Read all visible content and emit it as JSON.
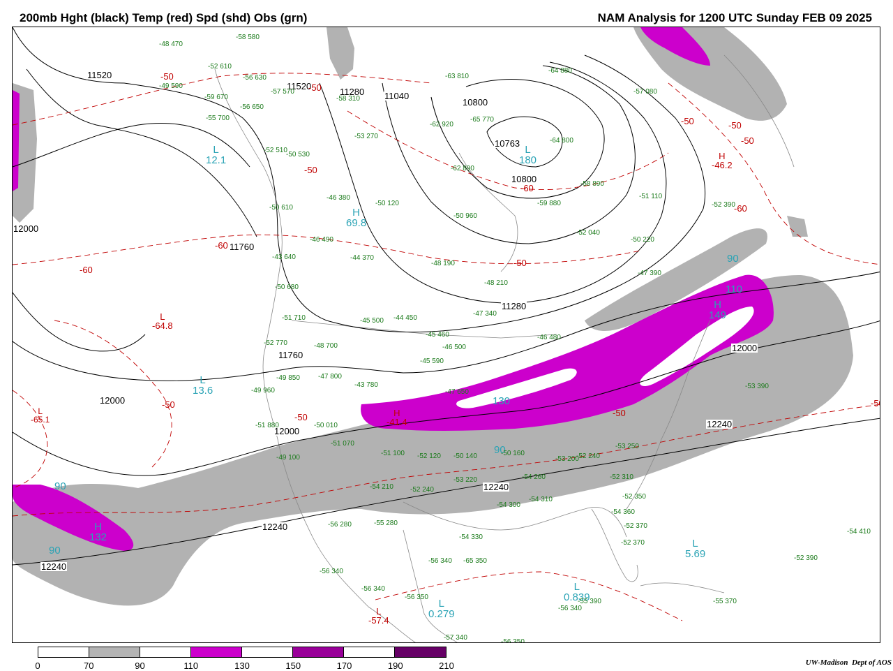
{
  "header": {
    "left": "200mb Hght (black) Temp (red) Spd (shd) Obs (grn)",
    "right": "NAM Analysis for 1200 UTC Sunday  FEB 09 2025"
  },
  "height_labels": [
    "11520",
    "11520",
    "11280",
    "11040",
    "10800",
    "10763",
    "10800",
    "12000",
    "11760",
    "11280",
    "11760",
    "12000",
    "12000",
    "12000",
    "12240",
    "12240",
    "12240",
    "12240",
    "12000"
  ],
  "temp_labels": [
    "-50",
    "-50",
    "-50",
    "-50",
    "-60",
    "-50",
    "-60",
    "-50",
    "-60",
    "-50",
    "-60",
    "-50",
    "-50",
    "-50",
    "-50",
    "-50",
    "-60"
  ],
  "speed_labels": [
    "90",
    "90",
    "90",
    "90",
    "130",
    "110"
  ],
  "centers": [
    {
      "letter": "L",
      "value": "12.1",
      "kind": "spd"
    },
    {
      "letter": "H",
      "value": "69.8",
      "kind": "spd"
    },
    {
      "letter": "L",
      "value": "180",
      "kind": "spd"
    },
    {
      "letter": "L",
      "value": "-64.8",
      "kind": "tmp"
    },
    {
      "letter": "H",
      "value": "-46.2",
      "kind": "tmp"
    },
    {
      "letter": "L",
      "value": "13.6",
      "kind": "spd"
    },
    {
      "letter": "L",
      "value": "-65.1",
      "kind": "tmp"
    },
    {
      "letter": "H",
      "value": "-41.4",
      "kind": "tmp"
    },
    {
      "letter": "H",
      "value": "149",
      "kind": "spd"
    },
    {
      "letter": "H",
      "value": "132",
      "kind": "spd"
    },
    {
      "letter": "L",
      "value": "5.69",
      "kind": "spd"
    },
    {
      "letter": "L",
      "value": "0.279",
      "kind": "spd"
    },
    {
      "letter": "L",
      "value": "0.839",
      "kind": "spd"
    },
    {
      "letter": "L",
      "value": "-57.4",
      "kind": "tmp"
    }
  ],
  "observations": [
    "-58 580",
    "-48 470",
    "-52 610",
    "-56 630",
    "-49 590",
    "-57 570",
    "-59 670",
    "-56 650",
    "-55 700",
    "-52 510",
    "-50 530",
    "-63 810",
    "-62 920",
    "-65 770",
    "-64 880",
    "-57 080",
    "-64 800",
    "-62 890",
    "-58 890",
    "-53 270",
    "-58 310",
    "-46 380",
    "-50 120",
    "-51 110",
    "-52 390",
    "-50 610",
    "-46 490",
    "-44 370",
    "-43 640",
    "-50 960",
    "-59 880",
    "-52 040",
    "-50 220",
    "-50 680",
    "-48 190",
    "-47 390",
    "-48 210",
    "-51 710",
    "-45 500",
    "-44 450",
    "-47 340",
    "-45 460",
    "-52 770",
    "-48 700",
    "-46 500",
    "-46 480",
    "-49 850",
    "-47 800",
    "-43 780",
    "-45 590",
    "-47 650",
    "-49 960",
    "-51 880",
    "-50 010",
    "-51 070",
    "-49 100",
    "-51 100",
    "-52 120",
    "-50 140",
    "-50 160",
    "-53 200",
    "-52 240",
    "-53 250",
    "-53 220",
    "-54 260",
    "-54 210",
    "-52 240",
    "-54 300",
    "-54 310",
    "-52 310",
    "-52 350",
    "-54 360",
    "-52 370",
    "-52 370",
    "-56 280",
    "-55 280",
    "-54 330",
    "-56 340",
    "-65 350",
    "-56 340",
    "-56 340",
    "-56 350",
    "-57 340",
    "-56 350",
    "-56 340",
    "-55 390",
    "-55 370",
    "-54 410",
    "-52 390",
    "-53 390",
    "-56 180"
  ],
  "colorbar": {
    "ticks": [
      "0",
      "70",
      "90",
      "110",
      "130",
      "150",
      "170",
      "190",
      "210"
    ],
    "colors": [
      "#ffffff",
      "#b4b4b4",
      "#ffffff",
      "#cc00cc",
      "#ffffff",
      "#990099",
      "#ffffff",
      "#660066"
    ]
  },
  "credit": {
    "org": "UW-Madison",
    "dept": "Dept of AOS"
  }
}
